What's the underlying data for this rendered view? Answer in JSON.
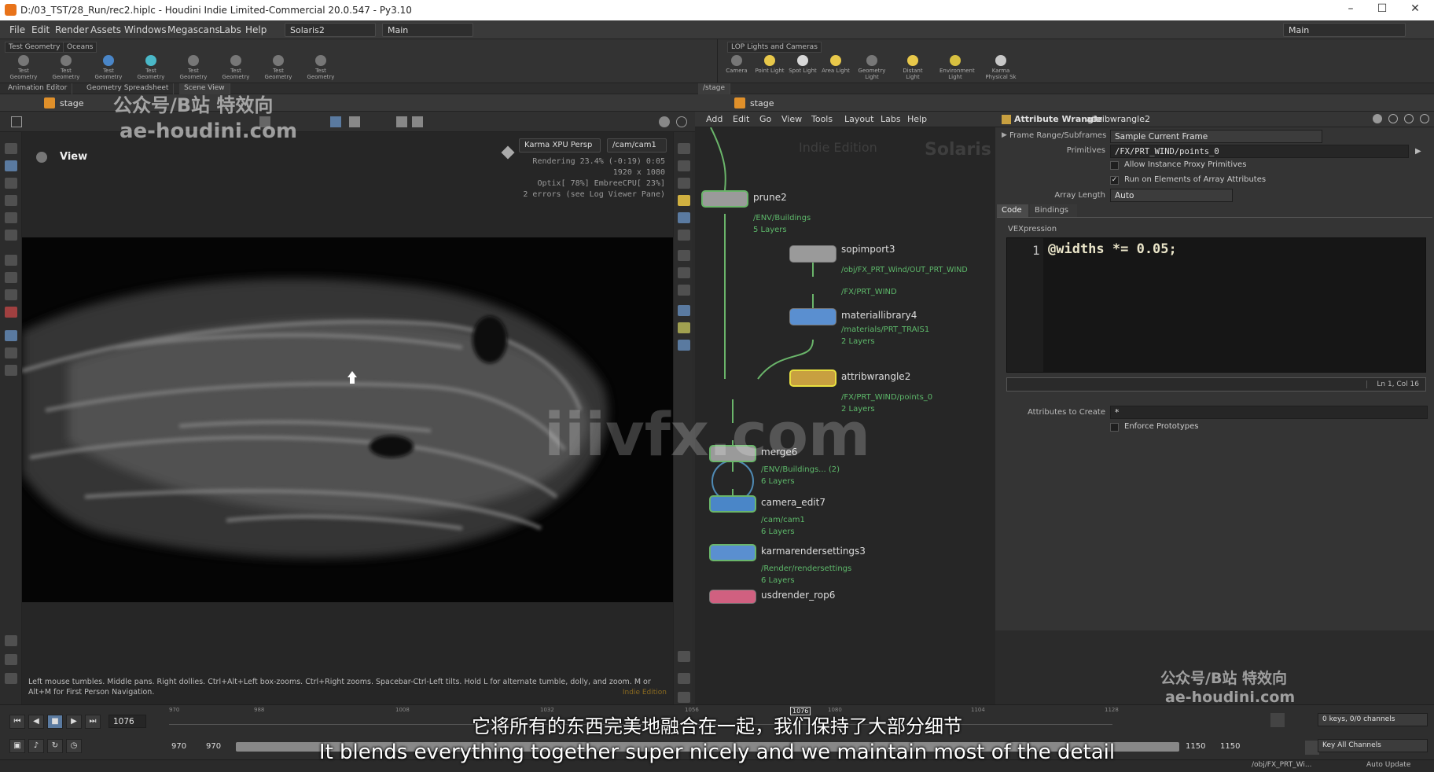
{
  "window": {
    "title": "D:/03_TST/28_Run/rec2.hiplc - Houdini Indie Limited-Commercial 20.0.547 - Py3.10",
    "minimize": "–",
    "maximize": "☐",
    "close": "✕"
  },
  "menubar": {
    "items": [
      "File",
      "Edit",
      "Render",
      "Assets",
      "Windows",
      "Megascans",
      "Labs",
      "Help"
    ],
    "desktop": "Solaris2",
    "context": "Main",
    "right_context": "Main"
  },
  "shelf_left": {
    "tabs": [
      "Test Geometry",
      "Oceans"
    ],
    "tools": [
      "Test Geometry",
      "Test Geometry",
      "Test Geometry",
      "Test Geometry",
      "Test Geometry",
      "Test Geometry",
      "Test Geometry",
      "Test Geometry"
    ]
  },
  "shelf_right": {
    "tabs": [
      "LOP Lights and Cameras"
    ],
    "tools": [
      "Camera",
      "Point Light",
      "Spot Light",
      "Area Light",
      "Geometry Light",
      "Distant Light",
      "Environment Light",
      "Karma Physical Sk"
    ]
  },
  "left_pane": {
    "tabs": [
      "Animation Editor",
      "Geometry Spreadsheet",
      "Scene View"
    ],
    "path": "stage"
  },
  "right_pane": {
    "tabs": [
      "/stage"
    ],
    "path": "stage"
  },
  "viewport": {
    "label": "View",
    "renderer": "Karma XPU Persp",
    "camera": "/cam/cam1",
    "stats": [
      "Rendering  23.4%  (-0:19)  0:05",
      "1920 x 1080",
      "Optix[ 78%] EmbreeCPU[ 23%]",
      "2 errors (see Log Viewer Pane)"
    ],
    "badge": "Indie Edition",
    "help": "Left mouse tumbles. Middle pans. Right dollies. Ctrl+Alt+Left box-zooms. Ctrl+Right zooms. Spacebar-Ctrl-Left tilts. Hold L for alternate tumble, dolly, and zoom. M or Alt+M for First Person Navigation."
  },
  "network_menu": [
    "Add",
    "Edit",
    "Go",
    "View",
    "Tools",
    "Layout",
    "Labs",
    "Help"
  ],
  "network": {
    "edition": "Indie Edition",
    "context": "Solaris",
    "nodes": [
      {
        "name": "prune2",
        "path": "/ENV/Buildings",
        "layers": "5 Layers",
        "color": "#9a9a9a"
      },
      {
        "name": "sopimport3",
        "path": "/obj/FX_PRT_Wind/OUT_PRT_WIND",
        "path2": "/FX/PRT_WIND",
        "layers": "",
        "color": "#9a9a9a"
      },
      {
        "name": "materiallibrary4",
        "path": "/materials/PRT_TRAIS1",
        "layers": "2 Layers",
        "color": "#5a8fd0"
      },
      {
        "name": "attribwrangle2",
        "path": "/FX/PRT_WIND/points_0",
        "layers": "2 Layers",
        "color": "#c8a040"
      },
      {
        "name": "merge6",
        "path": "/ENV/Buildings... (2)",
        "layers": "6 Layers",
        "color": "#9a9a9a"
      },
      {
        "name": "camera_edit7",
        "path": "/cam/cam1",
        "layers": "6 Layers",
        "color": "#4a86c8"
      },
      {
        "name": "karmarendersettings3",
        "path": "/Render/rendersettings",
        "layers": "6 Layers",
        "color": "#5a8fd0"
      },
      {
        "name": "usdrender_rop6",
        "path": "",
        "layers": "",
        "color": "#d06080"
      }
    ]
  },
  "params": {
    "node_type": "Attribute Wrangle",
    "node_name": "attribwrangle2",
    "frame_range_label": "Frame Range/Subframes",
    "frame_range_value": "Sample Current Frame",
    "primitives_label": "Primitives",
    "primitives_value": "/FX/PRT_WIND/points_0",
    "allow_instance": "Allow Instance Proxy Primitives",
    "run_on_elements": "Run on Elements of Array Attributes",
    "array_length_label": "Array Length",
    "array_length_value": "Auto",
    "tabs": [
      "Code",
      "Bindings"
    ],
    "vex_label": "VEXpression",
    "code_line_no": "1",
    "code": "@widths *= 0.05;",
    "cursor": "Ln 1, Col 16",
    "attr_create_label": "Attributes to Create",
    "attr_create_value": "*",
    "enforce_prototypes": "Enforce Prototypes"
  },
  "timeline": {
    "current_frame": "1076",
    "start": "970",
    "start2": "970",
    "end": "1150",
    "end2": "1150",
    "ticks": [
      "970",
      "988",
      "1008",
      "1032",
      "1056",
      "1080",
      "1104",
      "1128"
    ],
    "playhead": "1076",
    "keys": "0 keys, 0/0 channels",
    "key_all": "Key All Channels",
    "auto_update": "Auto Update",
    "obj_path": "/obj/FX_PRT_Wi..."
  },
  "subtitles": {
    "zh": "它将所有的东西完美地融合在一起，我们保持了大部分细节",
    "en": "It blends everything together super nicely and we maintain most of the detail"
  },
  "watermarks": {
    "top_line1": "公众号/B站 特效向",
    "top_line2": "ae-houdini.com",
    "center": "iiivfx.com",
    "bottom_line1": "公众号/B站 特效向",
    "bottom_line2": "ae-houdini.com"
  },
  "colors": {
    "wire": "#6ab56a",
    "node_text": "#5db86a",
    "accent": "#e8731a"
  }
}
